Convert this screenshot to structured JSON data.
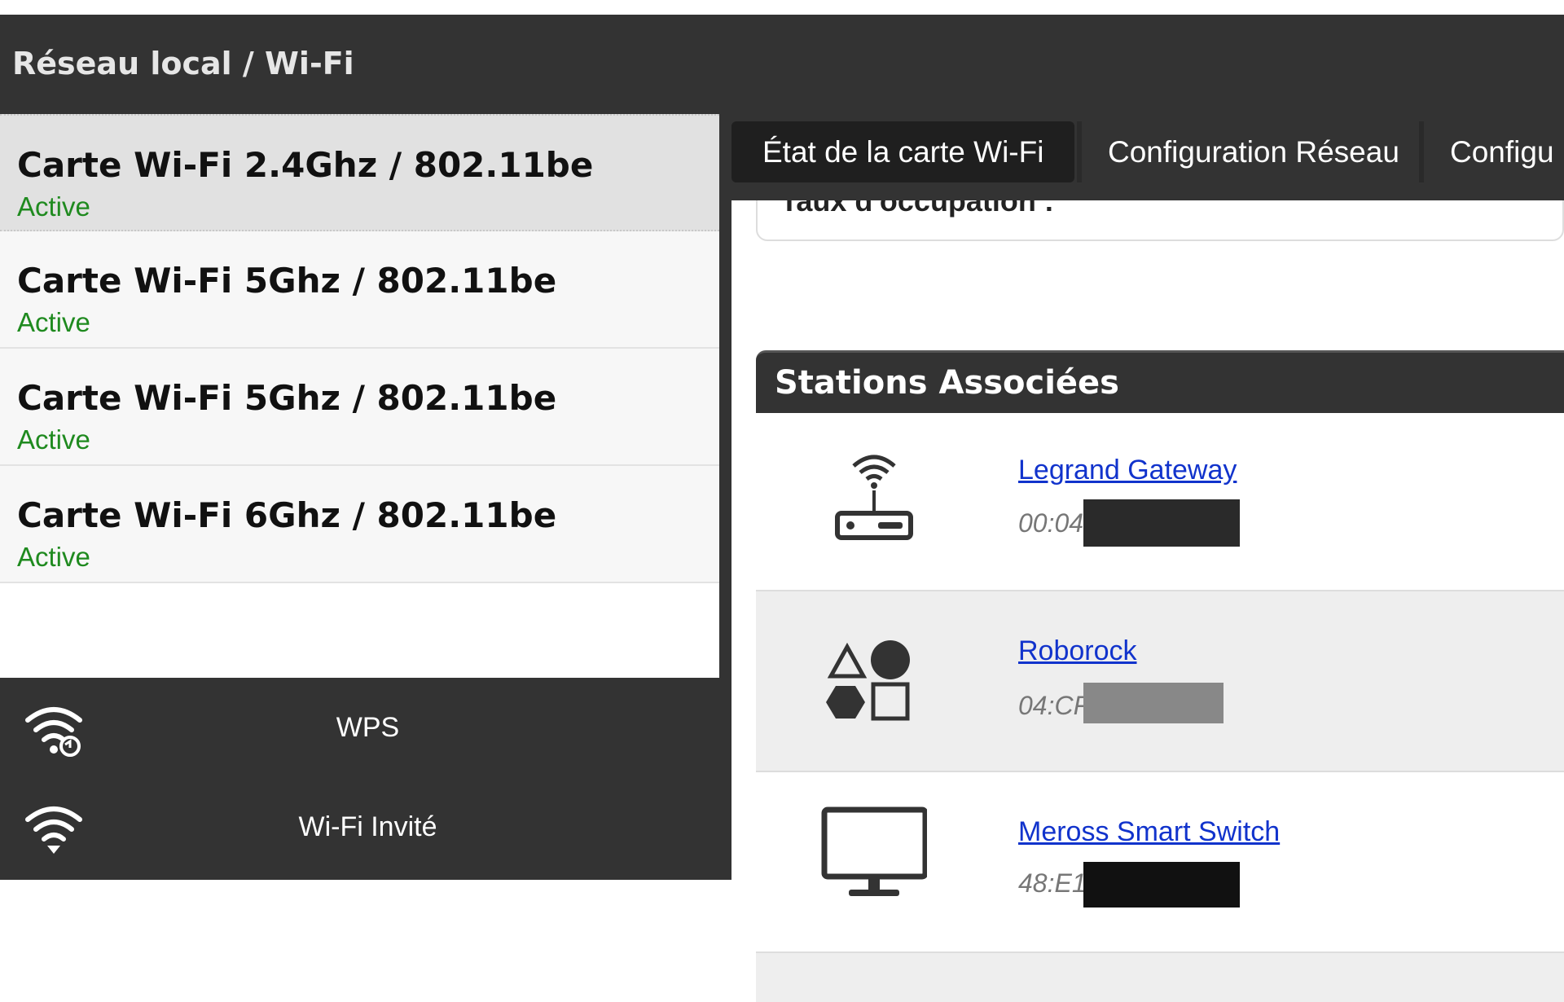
{
  "header": {
    "title": "Réseau local / Wi-Fi"
  },
  "cards": [
    {
      "title": "Carte Wi-Fi 2.4Ghz / 802.11be",
      "status": "Active"
    },
    {
      "title": "Carte Wi-Fi 5Ghz / 802.11be",
      "status": "Active"
    },
    {
      "title": "Carte Wi-Fi 5Ghz / 802.11be",
      "status": "Active"
    },
    {
      "title": "Carte Wi-Fi 6Ghz / 802.11be",
      "status": "Active"
    }
  ],
  "bottom_menu": [
    {
      "label": "WPS",
      "icon": "wifi-sync-icon"
    },
    {
      "label": "Wi-Fi Invité",
      "icon": "wifi-icon"
    }
  ],
  "tabs": [
    {
      "label": "État de la carte Wi-Fi",
      "active": true
    },
    {
      "label": "Configuration Réseau",
      "active": false
    },
    {
      "label": "Configu",
      "active": false
    }
  ],
  "clipped_section": {
    "label": "Taux d'occupation :"
  },
  "stations": {
    "title": "Stations Associées",
    "items": [
      {
        "name": "Legrand Gateway",
        "mac": "00:04",
        "icon": "router-icon"
      },
      {
        "name": "Roborock",
        "mac": "04:CF",
        "icon": "shapes-icon"
      },
      {
        "name": "Meross Smart Switch",
        "mac": "48:E1",
        "icon": "monitor-icon"
      }
    ]
  },
  "colors": {
    "header": "#333333",
    "active_status": "#1f8a1f",
    "link": "#1133cc"
  }
}
